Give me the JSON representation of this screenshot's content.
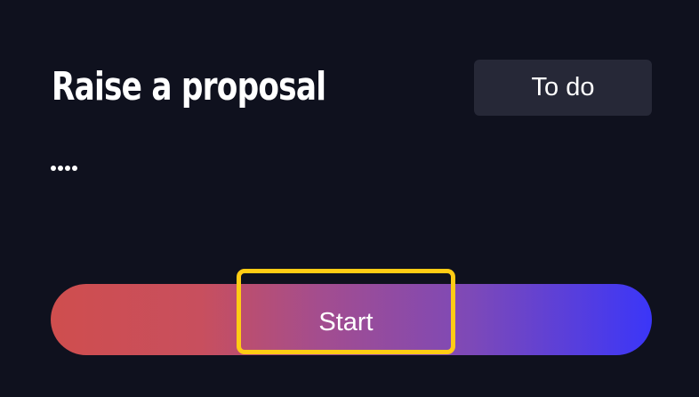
{
  "task": {
    "title": "Raise a proposal",
    "status": "To do",
    "start_label": "Start"
  },
  "colors": {
    "background": "#0f111e",
    "badge_bg": "#262837",
    "gradient_start": "#cf4e4e",
    "gradient_end": "#3b36f8",
    "highlight": "#ffcc14"
  },
  "icons": {
    "more": "more-dots-icon"
  }
}
